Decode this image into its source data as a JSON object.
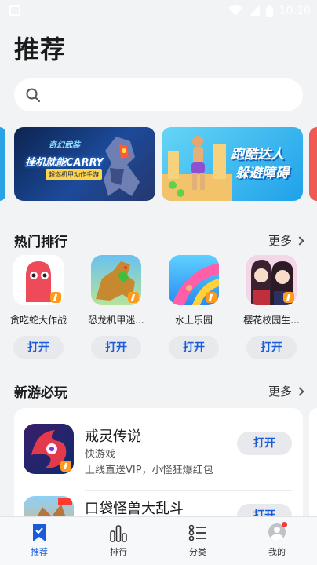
{
  "status_bar": {
    "time": "10:10"
  },
  "page": {
    "title": "推荐"
  },
  "search": {
    "placeholder": ""
  },
  "banners": [
    {
      "logo": "奇幻武装",
      "headline": "挂机就能CARRY",
      "subtitle": "超燃机甲动作手游"
    },
    {
      "line1": "跑酷达人",
      "line2": "躲避障碍"
    }
  ],
  "hot": {
    "title": "热门排行",
    "more": "更多",
    "items": [
      {
        "name": "贪吃蛇大作战",
        "button": "打开"
      },
      {
        "name": "恐龙机甲迷...",
        "button": "打开"
      },
      {
        "name": "水上乐园",
        "button": "打开"
      },
      {
        "name": "樱花校园生...",
        "button": "打开"
      }
    ]
  },
  "new_games": {
    "title": "新游必玩",
    "more": "更多",
    "items": [
      {
        "title": "戒灵传说",
        "category": "快游戏",
        "desc": "上线直送VIP，小怪狂爆红包",
        "button": "打开"
      },
      {
        "title": "口袋怪兽大乱斗",
        "category": "",
        "desc": "",
        "button": "打开"
      }
    ]
  },
  "tabbar": {
    "items": [
      {
        "label": "推荐",
        "icon": "bookmark-icon",
        "active": true
      },
      {
        "label": "排行",
        "icon": "bar-chart-icon",
        "active": false
      },
      {
        "label": "分类",
        "icon": "list-icon",
        "active": false
      },
      {
        "label": "我的",
        "icon": "avatar-icon",
        "active": false
      }
    ]
  },
  "colors": {
    "accent": "#1a5bdb",
    "badge": "#ff9b1a",
    "background": "#f1f3f5"
  }
}
